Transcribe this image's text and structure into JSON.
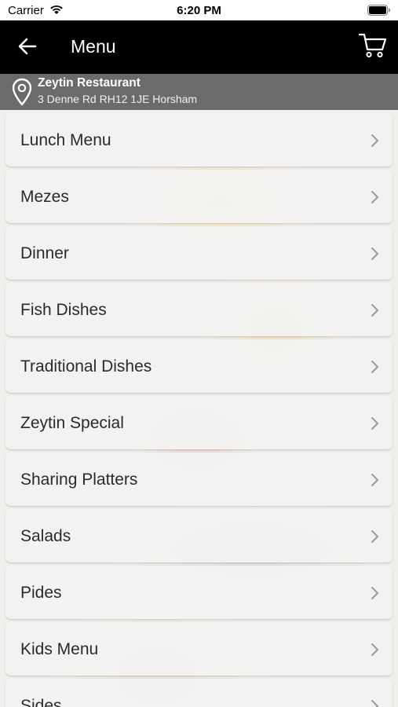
{
  "status_bar": {
    "carrier": "Carrier",
    "time": "6:20 PM",
    "icons": [
      "wifi-icon",
      "battery-icon"
    ]
  },
  "nav": {
    "title": "Menu",
    "back_icon": "arrow-left-icon",
    "cart_icon": "shopping-cart-icon"
  },
  "location": {
    "name": "Zeytin Restaurant",
    "address": "3 Denne Rd RH12 1JE Horsham",
    "icon": "location-pin-icon"
  },
  "menu": {
    "items": [
      {
        "label": "Lunch Menu"
      },
      {
        "label": "Mezes"
      },
      {
        "label": "Dinner"
      },
      {
        "label": "Fish Dishes"
      },
      {
        "label": "Traditional Dishes"
      },
      {
        "label": "Zeytin Special"
      },
      {
        "label": "Sharing Platters"
      },
      {
        "label": "Salads"
      },
      {
        "label": "Pides"
      },
      {
        "label": "Kids Menu"
      },
      {
        "label": "Sides"
      }
    ]
  },
  "colors": {
    "nav_bg": "#000000",
    "location_bg": "#6b6b6b",
    "item_bg": "#f2f2f2",
    "item_text": "#2a2a2a",
    "chevron": "#9a9a9a"
  }
}
